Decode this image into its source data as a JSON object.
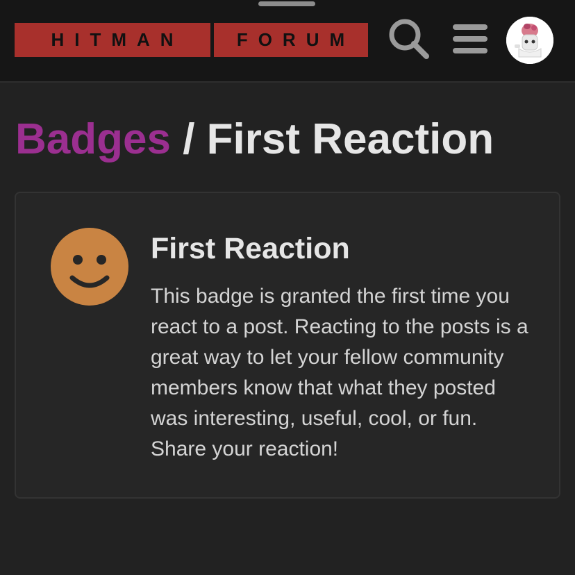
{
  "header": {
    "logo_left": "HITMAN",
    "logo_right": "FORUM",
    "search_icon": "search-icon",
    "menu_icon": "hamburger-menu-icon",
    "avatar_icon": "user-avatar"
  },
  "breadcrumb": {
    "parent": "Badges",
    "separator": " / ",
    "current": "First Reaction"
  },
  "badge": {
    "icon": "smiley-face-icon",
    "title": "First Reaction",
    "description": "This badge is granted the first time you react to a post. Reacting to the posts is a great way to let your fellow community members know that what they posted was interesting, useful, cool, or fun. Share your reaction!"
  },
  "colors": {
    "background": "#222222",
    "header_bg": "#161616",
    "logo_red": "#a8302c",
    "link_purple": "#9b2f90",
    "badge_orange": "#c98443",
    "text": "#e6e6e6"
  }
}
